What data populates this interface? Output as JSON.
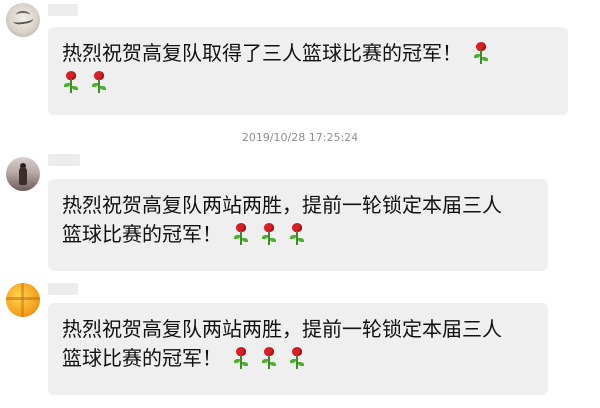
{
  "messages": [
    {
      "line1": "热烈祝贺高复队取得了三人篮球比赛的冠军！",
      "line2": "",
      "rose_name": "rose-icon"
    },
    {
      "line1": "热烈祝贺高复队两站两胜，提前一轮锁定本届三人",
      "line2": "篮球比赛的冠军！",
      "rose_name": "rose-icon"
    },
    {
      "line1": "热烈祝贺高复队两站两胜，提前一轮锁定本届三人",
      "line2": "篮球比赛的冠军！",
      "rose_name": "rose-icon"
    }
  ],
  "timestamp": "2019/10/28 17:25:24",
  "colors": {
    "bubble": "#efefef",
    "text": "#111111",
    "timestamp": "#8e8e8e",
    "rose": "#d61f26",
    "leaf": "#4caf2f"
  }
}
